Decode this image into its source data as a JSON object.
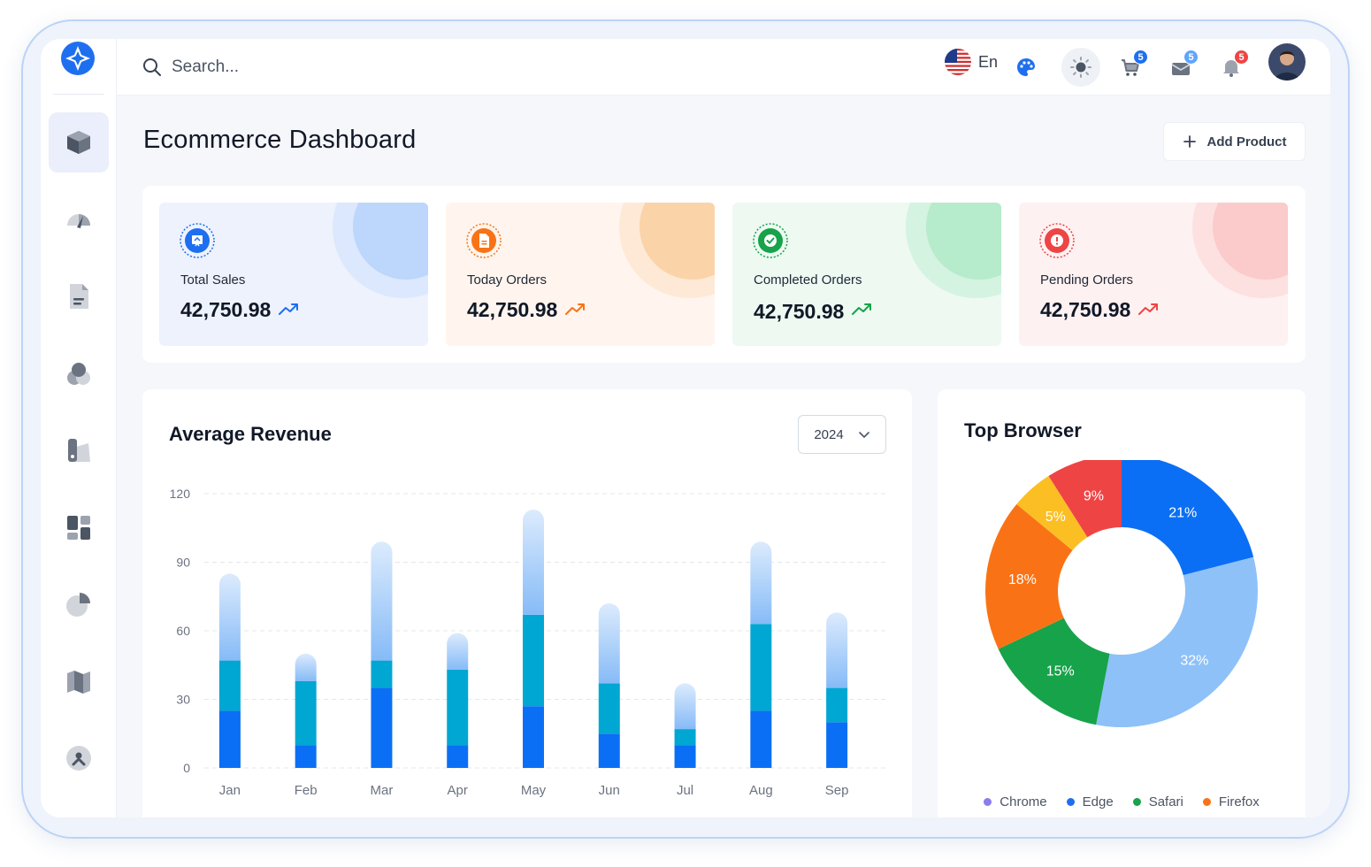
{
  "topbar": {
    "search_placeholder": "Search...",
    "language": "En",
    "cart_count": "5",
    "mail_count": "5",
    "notification_count": "5"
  },
  "page": {
    "title": "Ecommerce Dashboard",
    "add_button": "Add Product"
  },
  "stats": [
    {
      "label": "Total Sales",
      "value": "42,750.98",
      "color": "#1e6ff0",
      "bg": "#eef2fd",
      "circle1": "#dce8fd",
      "circle2": "#bdd6fb",
      "icon": "cart-board-icon"
    },
    {
      "label": "Today Orders",
      "value": "42,750.98",
      "color": "#f97316",
      "bg": "#fff5ee",
      "circle1": "#fde9d6",
      "circle2": "#fbd3a8",
      "icon": "document-icon"
    },
    {
      "label": "Completed Orders",
      "value": "42,750.98",
      "color": "#16a34a",
      "bg": "#edf9f1",
      "circle1": "#d4f3e0",
      "circle2": "#b6ebcb",
      "icon": "check-badge-icon"
    },
    {
      "label": "Pending Orders",
      "value": "42,750.98",
      "color": "#ef4444",
      "bg": "#fef1f1",
      "circle1": "#fde0e0",
      "circle2": "#fbcaca",
      "icon": "alert-clock-icon"
    }
  ],
  "revenue": {
    "title": "Average Revenue",
    "year": "2024"
  },
  "browser": {
    "title": "Top Browser"
  },
  "chart_data": [
    {
      "type": "bar",
      "title": "Average Revenue",
      "stacked": true,
      "categories": [
        "Jan",
        "Feb",
        "Mar",
        "Apr",
        "May",
        "Jun",
        "Jul",
        "Aug",
        "Sep"
      ],
      "ylim": [
        0,
        120
      ],
      "yticks": [
        0,
        30,
        60,
        90,
        120
      ],
      "grid": true,
      "series": [
        {
          "values": [
            25,
            10,
            35,
            10,
            27,
            15,
            10,
            25,
            20
          ],
          "color": "#0b6ff5"
        },
        {
          "values": [
            22,
            28,
            12,
            33,
            40,
            22,
            7,
            38,
            15
          ],
          "color": "#00a7d2"
        },
        {
          "values": [
            38,
            12,
            52,
            16,
            46,
            35,
            20,
            36,
            33
          ],
          "color": "#8ec1f8"
        }
      ]
    },
    {
      "type": "pie",
      "title": "Top Browser",
      "donut": true,
      "slices": [
        {
          "label": "21%",
          "value": 21,
          "color": "#0b6ff5"
        },
        {
          "label": "32%",
          "value": 32,
          "color": "#8ec1f8"
        },
        {
          "label": "15%",
          "value": 15,
          "color": "#16a34a"
        },
        {
          "label": "18%",
          "value": 18,
          "color": "#f97316"
        },
        {
          "label": "5%",
          "value": 5,
          "color": "#fbbf24"
        },
        {
          "label": "9%",
          "value": 9,
          "color": "#ef4444"
        }
      ],
      "legend": [
        {
          "name": "Chrome",
          "color": "#8b7cf0"
        },
        {
          "name": "Edge",
          "color": "#1e6ff0"
        },
        {
          "name": "Safari",
          "color": "#16a34a"
        },
        {
          "name": "Firefox",
          "color": "#f97316"
        }
      ],
      "legend_position": "bottom"
    }
  ]
}
